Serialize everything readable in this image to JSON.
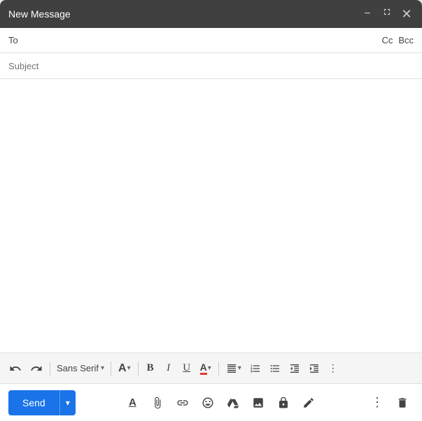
{
  "header": {
    "title": "New Message",
    "minimize_label": "minimize",
    "expand_label": "expand",
    "close_label": "close"
  },
  "fields": {
    "to_label": "To",
    "to_placeholder": "",
    "cc_label": "Cc",
    "bcc_label": "Bcc",
    "subject_label": "Subject",
    "subject_placeholder": ""
  },
  "toolbar": {
    "undo_label": "↺",
    "redo_label": "↻",
    "font_name": "Sans Serif",
    "font_size_label": "A",
    "bold_label": "B",
    "italic_label": "I",
    "underline_label": "U",
    "text_color_label": "A",
    "align_label": "≡",
    "numbered_list_label": "ol",
    "bulleted_list_label": "ul",
    "indent_less_label": "←",
    "indent_more_label": "→",
    "more_label": "⋮"
  },
  "bottom": {
    "send_label": "Send",
    "formatting_label": "A",
    "attach_label": "attach",
    "link_label": "link",
    "emoji_label": "emoji",
    "drive_label": "drive",
    "photo_label": "photo",
    "confidential_label": "lock",
    "signature_label": "pen",
    "more_options_label": "⋮",
    "discard_label": "trash"
  }
}
